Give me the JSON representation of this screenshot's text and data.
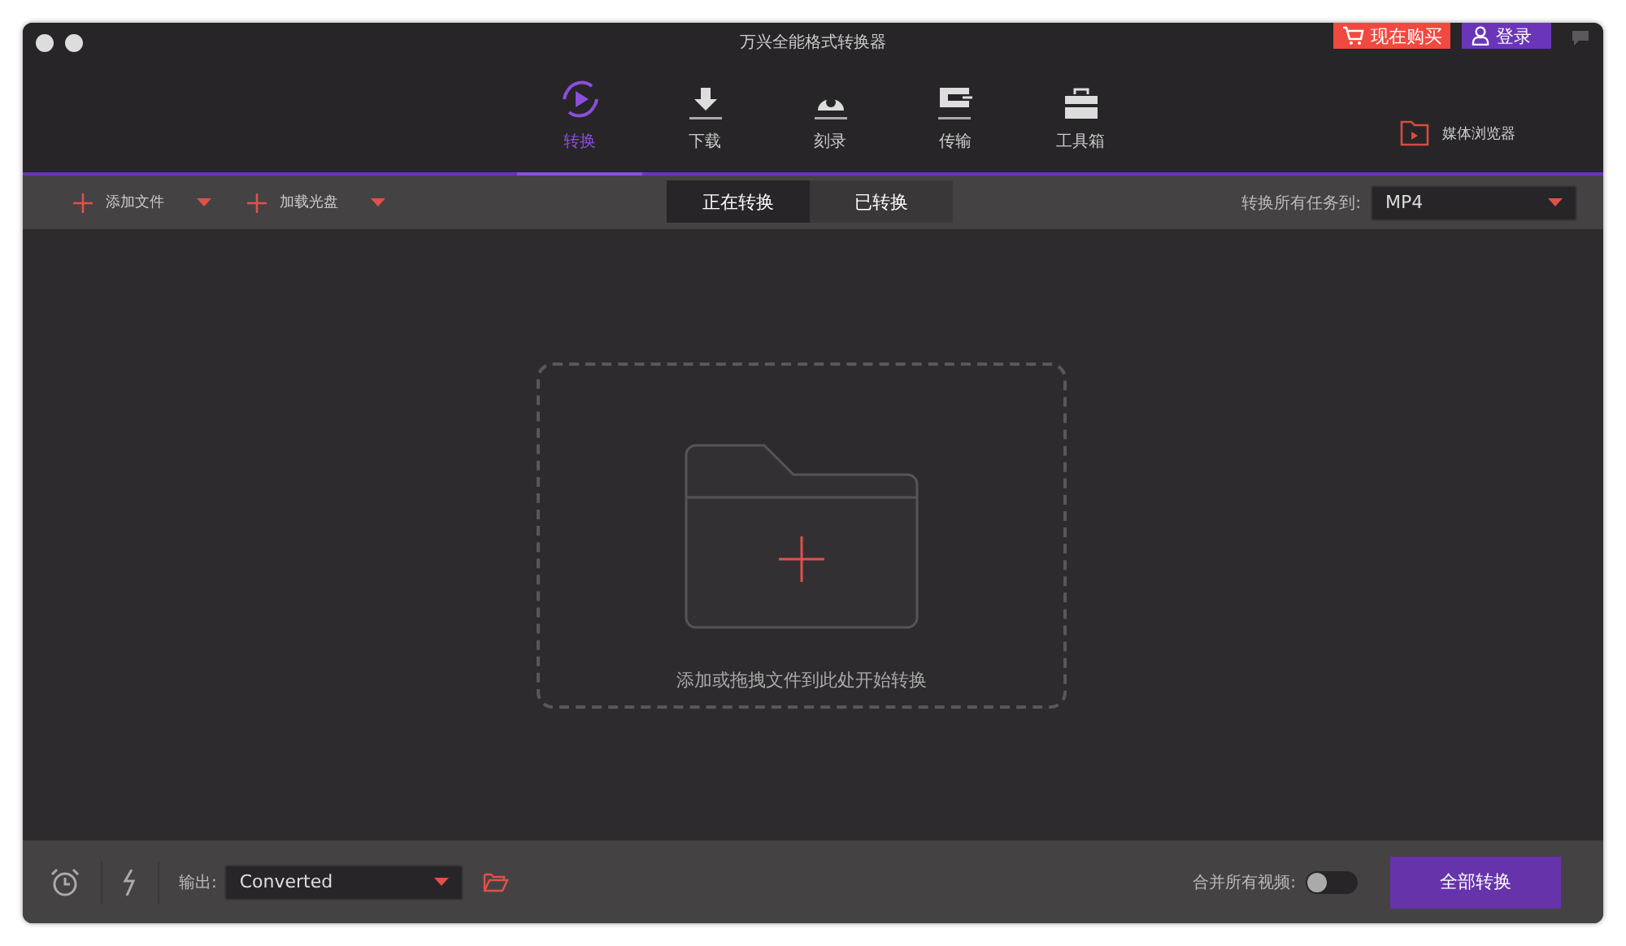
{
  "window": {
    "title": "万兴全能格式转换器"
  },
  "header_buttons": {
    "buy": "现在购买",
    "login": "登录"
  },
  "tabs": [
    {
      "kind": "convert",
      "label": "转换",
      "selected": true
    },
    {
      "kind": "download",
      "label": "下载",
      "selected": false
    },
    {
      "kind": "burn",
      "label": "刻录",
      "selected": false
    },
    {
      "kind": "transfer",
      "label": "传输",
      "selected": false
    },
    {
      "kind": "toolbox",
      "label": "工具箱",
      "selected": false
    }
  ],
  "media_browser": "媒体浏览器",
  "toolbar": {
    "add_file": "添加文件",
    "load_disc": "加载光盘",
    "segments": [
      {
        "label": "正在转换",
        "selected": true
      },
      {
        "label": "已转换",
        "selected": false
      }
    ],
    "convert_all_to_label": "转换所有任务到:",
    "format": "MP4"
  },
  "drop_zone": {
    "hint": "添加或拖拽文件到此处开始转换"
  },
  "bottom_bar": {
    "output_label": "输出:",
    "output_path": "Converted",
    "merge_label": "合并所有视频:",
    "merge_on": false,
    "convert_all": "全部转换"
  }
}
